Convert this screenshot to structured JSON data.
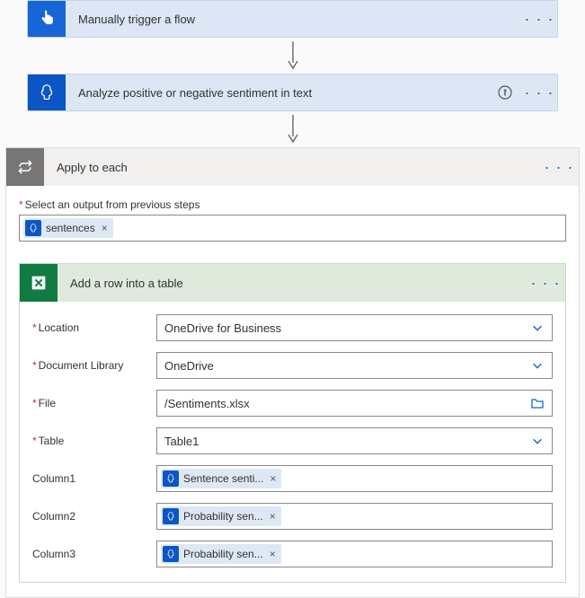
{
  "steps": {
    "trigger": {
      "title": "Manually trigger a flow"
    },
    "analyze": {
      "title": "Analyze positive or negative sentiment in text"
    }
  },
  "foreach": {
    "title": "Apply to each",
    "input_label": "Select an output from previous steps",
    "token": "sentences"
  },
  "excel": {
    "title": "Add a row into a table",
    "labels": {
      "location": "Location",
      "document_library": "Document Library",
      "file": "File",
      "table": "Table",
      "column1": "Column1",
      "column2": "Column2",
      "column3": "Column3"
    },
    "location": "OneDrive for Business",
    "document_library": "OneDrive",
    "file": "/Sentiments.xlsx",
    "table": "Table1",
    "column1_token": "Sentence senti...",
    "column2_token": "Probability sen...",
    "column3_token": "Probability sen..."
  },
  "glyphs": {
    "ellipsis": "· · ·",
    "close": "×"
  }
}
